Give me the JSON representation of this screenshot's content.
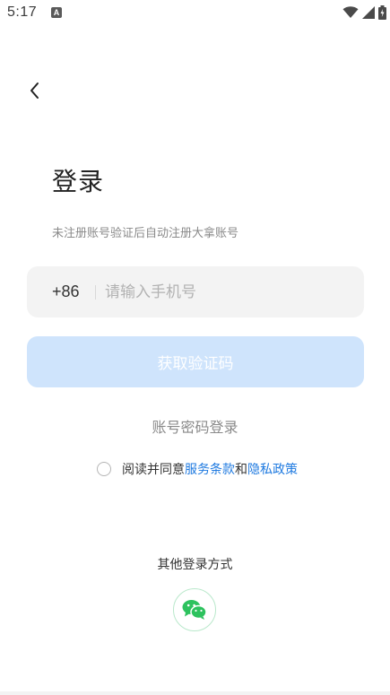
{
  "status_bar": {
    "time": "5:17",
    "notification_icon": "a-icon",
    "icons": [
      "wifi-icon",
      "signal-icon",
      "battery-icon"
    ]
  },
  "header": {
    "back_icon": "chevron-left-icon"
  },
  "login": {
    "title": "登录",
    "subtitle": "未注册账号验证后自动注册大拿账号",
    "country_code": "+86",
    "phone_placeholder": "请输入手机号",
    "phone_value": "",
    "get_code_label": "获取验证码",
    "password_login_label": "账号密码登录"
  },
  "agreement": {
    "checked": false,
    "prefix": "阅读并同意",
    "terms_label": "服务条款",
    "conjunction": "和",
    "privacy_label": "隐私政策"
  },
  "other_login": {
    "title": "其他登录方式",
    "methods": [
      "wechat-icon"
    ]
  },
  "colors": {
    "accent": "#1f7ae0",
    "button_disabled": "#cfe4fc",
    "input_bg": "#f3f3f3",
    "wechat_green": "#2dc25e"
  }
}
